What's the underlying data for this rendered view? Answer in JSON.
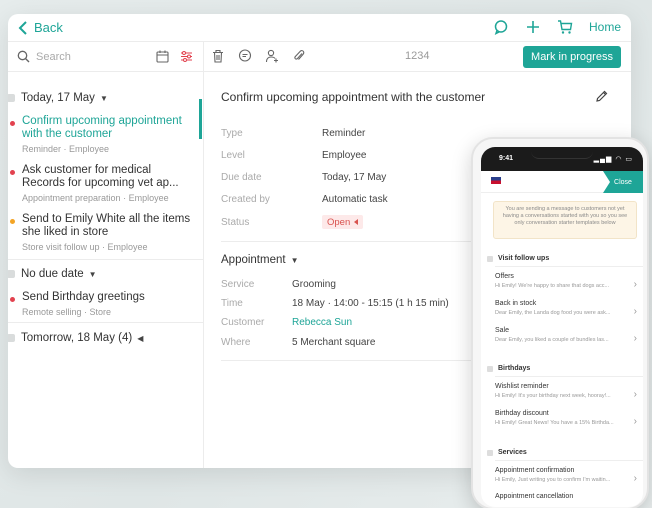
{
  "top": {
    "back": "Back",
    "home": "Home"
  },
  "toolbar": {
    "search_placeholder": "Search",
    "ticket_id": "1234",
    "mark_in_progress": "Mark in progress"
  },
  "list": {
    "today_header": "Today, 17 May",
    "no_due_header": "No due date",
    "tomorrow_header": "Tomorrow, 18 May (4)",
    "tasks": [
      {
        "title": "Confirm upcoming appointment with the customer",
        "meta": "Reminder · Employee",
        "dot": "#e2424f"
      },
      {
        "title": "Ask customer for medical Records for upcoming vet ap...",
        "meta": "Appointment preparation · Employee",
        "dot": "#e2424f"
      },
      {
        "title": "Send to Emily White all the items she liked in store",
        "meta": "Store visit follow up · Employee",
        "dot": "#f3a425"
      },
      {
        "title": "Send Birthday greetings",
        "meta": "Remote selling · Store",
        "dot": "#e2424f"
      }
    ]
  },
  "detail": {
    "title": "Confirm upcoming appointment with the customer",
    "fields": [
      {
        "label": "Type",
        "value": "Reminder"
      },
      {
        "label": "Level",
        "value": "Employee"
      },
      {
        "label": "Due date",
        "value": "Today, 17 May"
      },
      {
        "label": "Created by",
        "value": "Automatic task"
      },
      {
        "label": "Status",
        "value": "Open"
      }
    ],
    "appointment_header": "Appointment",
    "appointment": [
      {
        "label": "Service",
        "value": "Grooming"
      },
      {
        "label": "Time",
        "value": "18 May · 14:00 - 15:15 (1 h 15 min)"
      },
      {
        "label": "Customer",
        "value": "Rebecca Sun"
      },
      {
        "label": "Where",
        "value": "5 Merchant square"
      }
    ]
  },
  "phone": {
    "time": "9:41",
    "signal": "▂▄▆ ◠ ▭",
    "close": "Close",
    "note": "You are sending a message to customers not yet having a conversations started with you so you see only conversation starter templates below",
    "sections": [
      {
        "title": "Visit follow ups",
        "items": [
          {
            "title": "Offers",
            "sub": "Hi Emily! We're happy to share that dogs acc..."
          },
          {
            "title": "Back in stock",
            "sub": "Dear Emily, the Landa dog food you were ask..."
          },
          {
            "title": "Sale",
            "sub": "Dear Emily, you liked a couple of bundles las..."
          }
        ]
      },
      {
        "title": "Birthdays",
        "items": [
          {
            "title": "Wishlist reminder",
            "sub": "Hi Emily! It's your birthday next week, hooray!..."
          },
          {
            "title": "Birthday discount",
            "sub": "Hi Emily! Great News! You have a 15% Birthda..."
          }
        ]
      },
      {
        "title": "Services",
        "items": [
          {
            "title": "Appointment confirmation",
            "sub": "Hi Emily, Just writing you to confirm I'm waitin..."
          },
          {
            "title": "Appointment cancellation",
            "sub": ""
          }
        ]
      }
    ]
  },
  "colors": {
    "accent": "#1ea597",
    "status_open": "#d9534f"
  }
}
